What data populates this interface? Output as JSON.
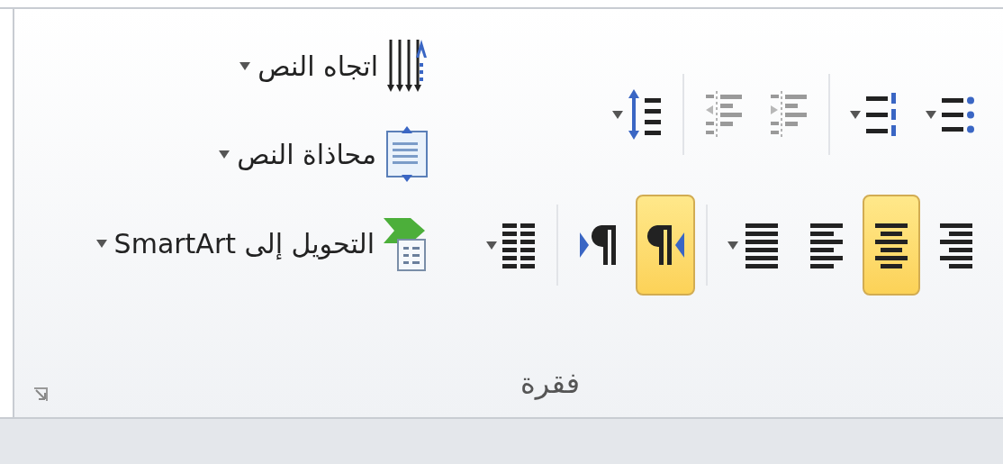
{
  "group": {
    "label": "فقرة"
  },
  "row_1": [
    [
      {
        "kind": "bullets",
        "selected": false,
        "disabled": false,
        "dropdown": true
      },
      {
        "kind": "numbering",
        "selected": false,
        "disabled": false,
        "dropdown": true
      }
    ],
    [
      {
        "kind": "indent_increase",
        "selected": false,
        "disabled": true,
        "dropdown": false
      },
      {
        "kind": "indent_decrease",
        "selected": false,
        "disabled": true,
        "dropdown": false
      }
    ],
    [
      {
        "kind": "line_spacing",
        "selected": false,
        "disabled": false,
        "dropdown": true
      }
    ]
  ],
  "row_2": [
    [
      {
        "kind": "align_right",
        "selected": false,
        "disabled": false,
        "dropdown": false
      },
      {
        "kind": "align_center",
        "selected": true,
        "disabled": false,
        "dropdown": false
      },
      {
        "kind": "align_left",
        "selected": false,
        "disabled": false,
        "dropdown": false
      },
      {
        "kind": "justify",
        "selected": false,
        "disabled": false,
        "dropdown": true
      }
    ],
    [
      {
        "kind": "rtl",
        "selected": true,
        "disabled": false,
        "dropdown": false
      },
      {
        "kind": "ltr",
        "selected": false,
        "disabled": false,
        "dropdown": false
      }
    ],
    [
      {
        "kind": "columns",
        "selected": false,
        "disabled": false,
        "dropdown": true
      }
    ]
  ],
  "commands": [
    {
      "kind": "text_direction",
      "label": "اتجاه النص",
      "dropdown": true
    },
    {
      "kind": "align_text",
      "label": "محاذاة النص",
      "dropdown": true
    },
    {
      "kind": "smartart",
      "label": "التحويل إلى SmartArt",
      "dropdown": true
    }
  ]
}
